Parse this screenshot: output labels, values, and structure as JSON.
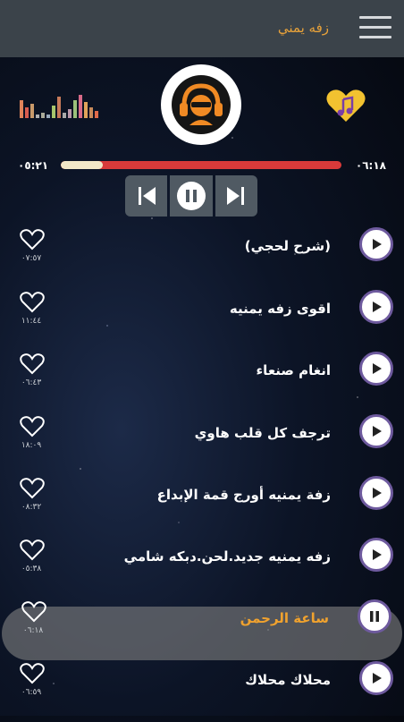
{
  "header": {
    "title": "زفه يمني",
    "menu_icon": "hamburger-menu-icon"
  },
  "player": {
    "elapsed": "٠٥:٢١",
    "total": "٠٦:١٨",
    "progress_fraction": 0.15,
    "logo_icon": "headphones-person-icon",
    "favorite_icon": "heart-music-note-icon",
    "equalizer_icon": "equalizer-bars-icon",
    "controls": {
      "prev_icon": "skip-previous-icon",
      "pause_icon": "pause-icon",
      "next_icon": "skip-next-icon"
    }
  },
  "tracks": [
    {
      "title": "(شرح لحجي)",
      "duration": "٠٧:٥٧",
      "active": false
    },
    {
      "title": "اقوى زفه يمنيه",
      "duration": "١١:٤٤",
      "active": false
    },
    {
      "title": "انغام صنعاء",
      "duration": "٠٦:٤٣",
      "active": false
    },
    {
      "title": "ترجف كل قلب هاوي",
      "duration": "١٨:٠٩",
      "active": false
    },
    {
      "title": "زفة يمنيه أورج قمة الإبداع",
      "duration": "٠٨:٣٢",
      "active": false
    },
    {
      "title": "زفه يمنيه جديد.لحن.دبكه شامي",
      "duration": "٠٥:٣٨",
      "active": false
    },
    {
      "title": "ساعة الرحمن",
      "duration": "٠٦:١٨",
      "active": true
    },
    {
      "title": "محلاك محلاك",
      "duration": "٠٦:٥٩",
      "active": false
    }
  ],
  "colors": {
    "accent": "#e8a23a",
    "progress_track": "#d83a3a",
    "progress_fill": "#f2e8c8",
    "play_ring": "#6e5a9e"
  }
}
